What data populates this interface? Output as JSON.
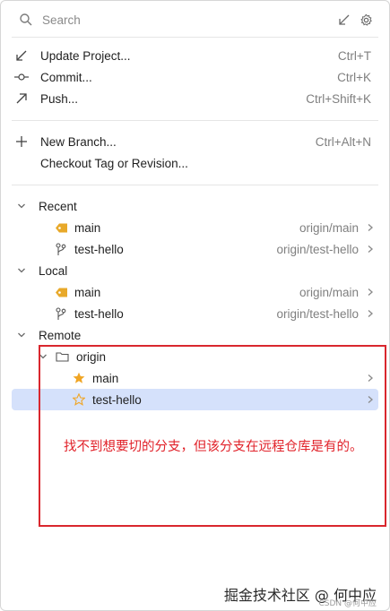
{
  "search": {
    "placeholder": "Search"
  },
  "actions": [
    {
      "label": "Update Project...",
      "shortcut": "Ctrl+T"
    },
    {
      "label": "Commit...",
      "shortcut": "Ctrl+K"
    },
    {
      "label": "Push...",
      "shortcut": "Ctrl+Shift+K"
    }
  ],
  "branch_actions": [
    {
      "label": "New Branch...",
      "shortcut": "Ctrl+Alt+N"
    },
    {
      "label": "Checkout Tag or Revision...",
      "shortcut": ""
    }
  ],
  "recent": {
    "title": "Recent",
    "items": [
      {
        "name": "main",
        "tracking": "origin/main"
      },
      {
        "name": "test-hello",
        "tracking": "origin/test-hello"
      }
    ]
  },
  "local": {
    "title": "Local",
    "items": [
      {
        "name": "main",
        "tracking": "origin/main"
      },
      {
        "name": "test-hello",
        "tracking": "origin/test-hello"
      }
    ]
  },
  "remote": {
    "title": "Remote",
    "folder": "origin",
    "items": [
      {
        "name": "main"
      },
      {
        "name": "test-hello"
      }
    ]
  },
  "annotation": {
    "text": "找不到想要切的分支，但该分支在远程仓库是有的。",
    "color": "#e1222a"
  },
  "watermark": {
    "main": "掘金技术社区 @ 何中应",
    "sub": "CSDN @何中应"
  },
  "colors": {
    "selection": "#d5e1fb",
    "tag_icon": "#e8a92a",
    "star_icon": "#f0a524"
  }
}
